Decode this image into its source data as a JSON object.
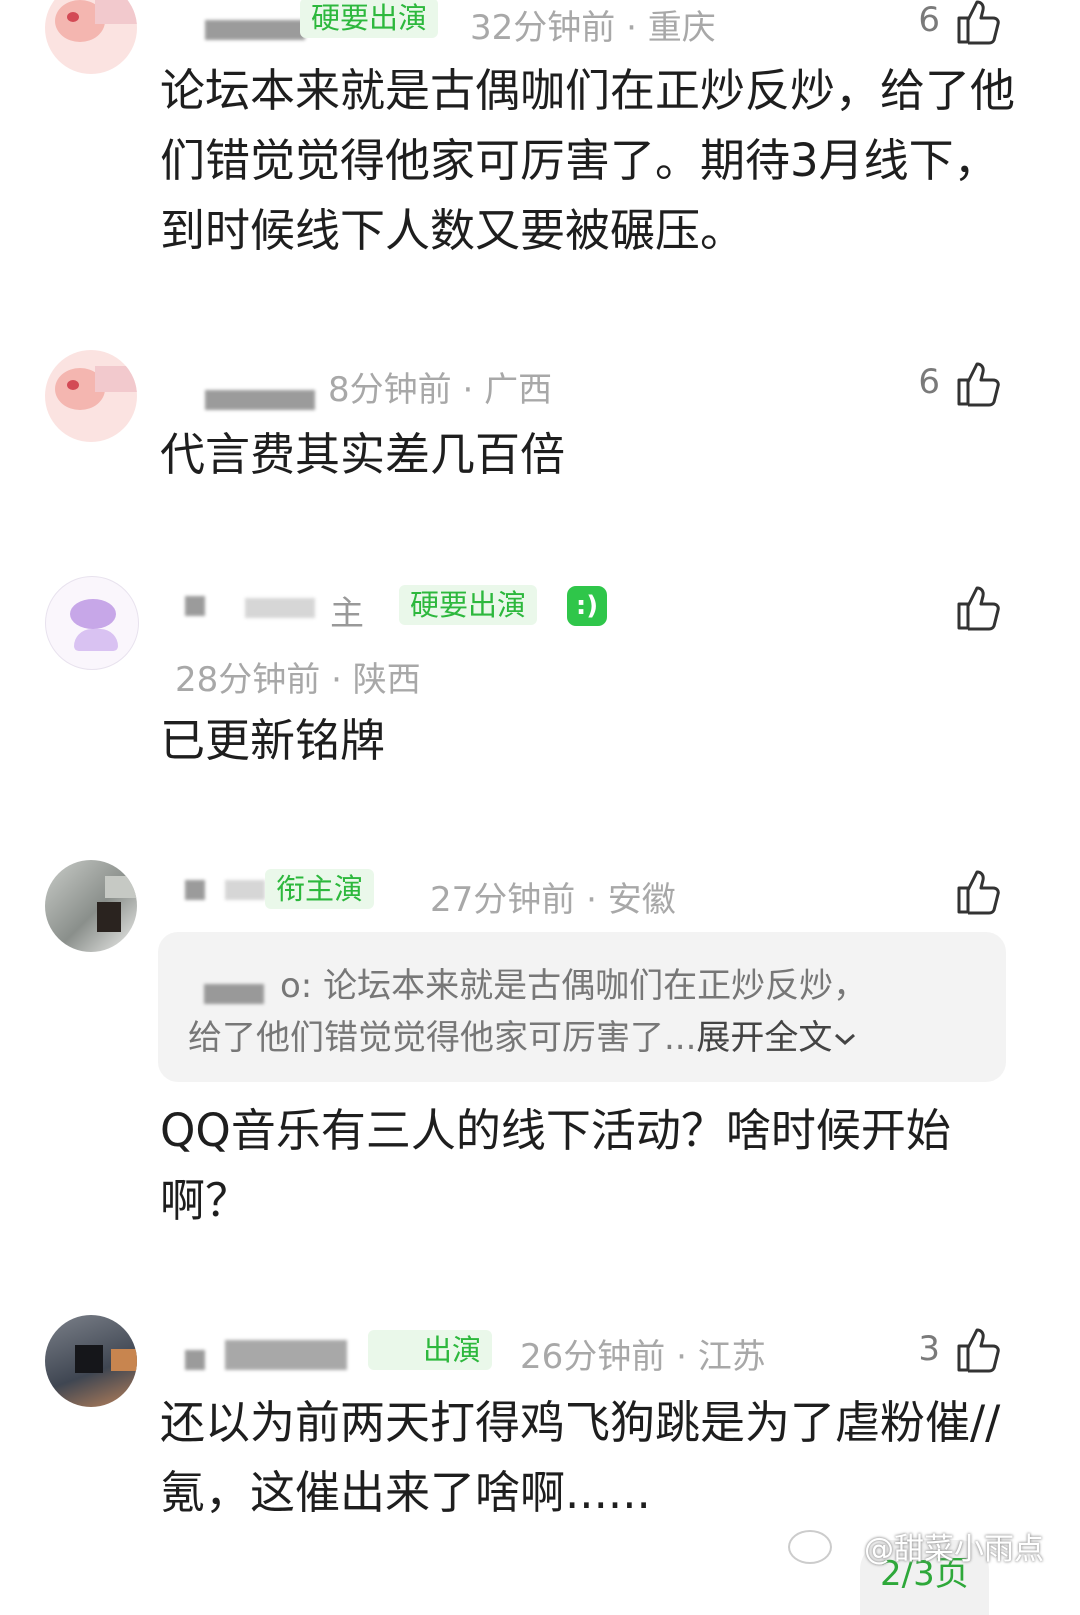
{
  "comments": [
    {
      "badge": "硬要出演",
      "time": "32分钟前",
      "sep": "·",
      "location": "重庆",
      "likes": "6",
      "text": "论坛本来就是古偶咖们在正炒反炒，给了他们错觉觉得他家可厉害了。期待3月线下，到时候线下人数又要被碾压。"
    },
    {
      "time": "8分钟前",
      "sep": "·",
      "location": "广西",
      "likes": "6",
      "text": "代言费其实差几百倍"
    },
    {
      "role": "主",
      "badge": "硬要出演",
      "time": "28分钟前",
      "sep": "·",
      "location": "陕西",
      "text": "已更新铭牌"
    },
    {
      "badge": "衔主演",
      "time": "27分钟前",
      "sep": "·",
      "location": "安徽",
      "quote_author_suffix": "o:",
      "quote_line1": "论坛本来就是古偶咖们在正炒反炒，",
      "quote_line2": "给了他们错觉觉得他家可厉害了...",
      "expand_label": "展开全文",
      "text": "QQ音乐有三人的线下活动？啥时候开始啊？"
    },
    {
      "badge": "出演",
      "time": "26分钟前",
      "sep": "·",
      "location": "江苏",
      "likes": "3",
      "text": "还以为前两天打得鸡飞狗跳是为了虐粉催//氪，这催出来了啥啊......"
    }
  ],
  "page_indicator": "2/3页",
  "watermark": "@甜菜小雨点",
  "icons": {
    "like": "thumbs-up-icon",
    "expand": "chevron-down-icon",
    "emoji": "green-emoji-icon"
  },
  "colors": {
    "badge_text": "#2db83d",
    "badge_bg": "#eaf8ea",
    "meta": "#a8a8a8",
    "body_text": "#1e1e1e"
  }
}
